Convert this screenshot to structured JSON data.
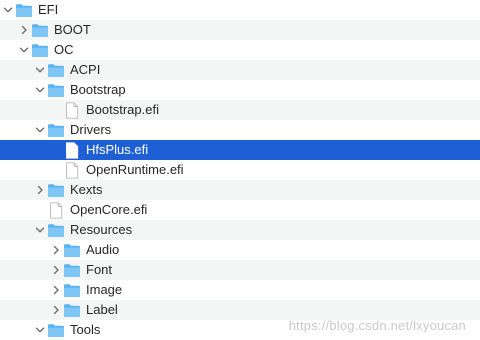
{
  "colors": {
    "folder_fill": "#5ab4f0",
    "folder_tab": "#7dc6f6",
    "selection": "#1f5fd6",
    "alt_row": "#f4f5f5",
    "chevron": "#6e6e6e"
  },
  "tree": [
    {
      "label": "EFI",
      "depth": 0,
      "kind": "folder",
      "expanded": true,
      "name": "row-efi"
    },
    {
      "label": "BOOT",
      "depth": 1,
      "kind": "folder",
      "expanded": false,
      "name": "row-boot"
    },
    {
      "label": "OC",
      "depth": 1,
      "kind": "folder",
      "expanded": true,
      "name": "row-oc"
    },
    {
      "label": "ACPI",
      "depth": 2,
      "kind": "folder",
      "expanded": true,
      "name": "row-acpi"
    },
    {
      "label": "Bootstrap",
      "depth": 2,
      "kind": "folder",
      "expanded": true,
      "name": "row-bootstrap"
    },
    {
      "label": "Bootstrap.efi",
      "depth": 3,
      "kind": "file",
      "name": "row-bootstrap-efi"
    },
    {
      "label": "Drivers",
      "depth": 2,
      "kind": "folder",
      "expanded": true,
      "name": "row-drivers"
    },
    {
      "label": "HfsPlus.efi",
      "depth": 3,
      "kind": "file",
      "selected": true,
      "name": "row-hfsplus-efi"
    },
    {
      "label": "OpenRuntime.efi",
      "depth": 3,
      "kind": "file",
      "name": "row-openruntime-efi"
    },
    {
      "label": "Kexts",
      "depth": 2,
      "kind": "folder",
      "expanded": false,
      "name": "row-kexts"
    },
    {
      "label": "OpenCore.efi",
      "depth": 2,
      "kind": "file",
      "name": "row-opencore-efi"
    },
    {
      "label": "Resources",
      "depth": 2,
      "kind": "folder",
      "expanded": true,
      "name": "row-resources"
    },
    {
      "label": "Audio",
      "depth": 3,
      "kind": "folder",
      "expanded": false,
      "name": "row-audio"
    },
    {
      "label": "Font",
      "depth": 3,
      "kind": "folder",
      "expanded": false,
      "name": "row-font"
    },
    {
      "label": "Image",
      "depth": 3,
      "kind": "folder",
      "expanded": false,
      "name": "row-image"
    },
    {
      "label": "Label",
      "depth": 3,
      "kind": "folder",
      "expanded": false,
      "name": "row-label"
    },
    {
      "label": "Tools",
      "depth": 2,
      "kind": "folder",
      "expanded": true,
      "name": "row-tools"
    }
  ],
  "watermark": "https://blog.csdn.net/lxyoucan"
}
